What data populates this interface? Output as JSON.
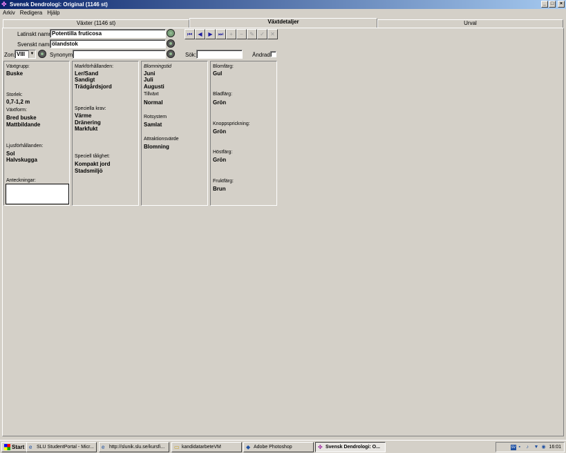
{
  "window": {
    "title": "Svensk Dendrologi: Original (1146 st)",
    "min": "_",
    "max": "□",
    "close": "×"
  },
  "menu": [
    "Arkiv",
    "Redigera",
    "Hjälp"
  ],
  "tabs": [
    "Växter (1146 st)",
    "Växtdetaljer",
    "Urval"
  ],
  "form": {
    "latin_label": "Latinskt namn:",
    "latin_value": "Potentilla fruticosa",
    "swedish_label": "Svenskt namn:",
    "swedish_value": "ölandstok",
    "zone_label": "Zon:",
    "zone_value": "VIII",
    "synonym_label": "Synonym:",
    "synonym_value": "",
    "search_label": "Sök:",
    "search_value": "",
    "changed_label": "Ändrad:"
  },
  "nav": [
    "⏮",
    "◀",
    "▶",
    "⏭",
    "+",
    "−",
    "✎",
    "✓",
    "✕"
  ],
  "col1": {
    "group_label": "Växtgrupp:",
    "group_value": "Buske",
    "size_label": "Storlek:",
    "size_value": "0,7-1,2 m",
    "form_label": "Växtform:",
    "form_values": [
      "Bred buske",
      "Mattbildande"
    ],
    "light_label": "Ljusförhållanden:",
    "light_values": [
      "Sol",
      "Halvskugga"
    ],
    "notes_label": "Anteckningar:"
  },
  "col2": {
    "soil_label": "Markförhållanden:",
    "soil_values": [
      "Ler/Sand",
      "Sandigt",
      "Trädgårdsjord"
    ],
    "special_label": "Speciella krav:",
    "special_values": [
      "Värme",
      "Dränering",
      "Markfukt"
    ],
    "tough_label": "Speciell tålighet:",
    "tough_values": [
      "Kompakt jord",
      "Stadsmiljö"
    ]
  },
  "col3": {
    "bloom_label": "Blomningstid",
    "bloom_values": [
      "Juni",
      "Juli",
      "Augusti"
    ],
    "growth_label": "Tillväxt",
    "growth_value": "Normal",
    "root_label": "Rotsystem",
    "root_value": "Samlat",
    "attr_label": "Attraktionsvärde",
    "attr_value": "Blomning"
  },
  "col4": {
    "flower_label": "Blomfärg:",
    "flower_value": "Gul",
    "leaf_label": "Bladfärg:",
    "leaf_value": "Grön",
    "bud_label": "Knoppsprickning:",
    "bud_value": "Grön",
    "autumn_label": "Höstfärg:",
    "autumn_value": "Grön",
    "fruit_label": "Fruktfärg:",
    "fruit_value": "Brun"
  },
  "taskbar": {
    "start": "Start",
    "items": [
      "SLU StudentPortal - Micr...",
      "http://slunik.slu.se/kursfi...",
      "kandidatarbeteVM",
      "Adobe Photoshop",
      "Svensk Dendrologi: O..."
    ],
    "clock": "16:01"
  }
}
